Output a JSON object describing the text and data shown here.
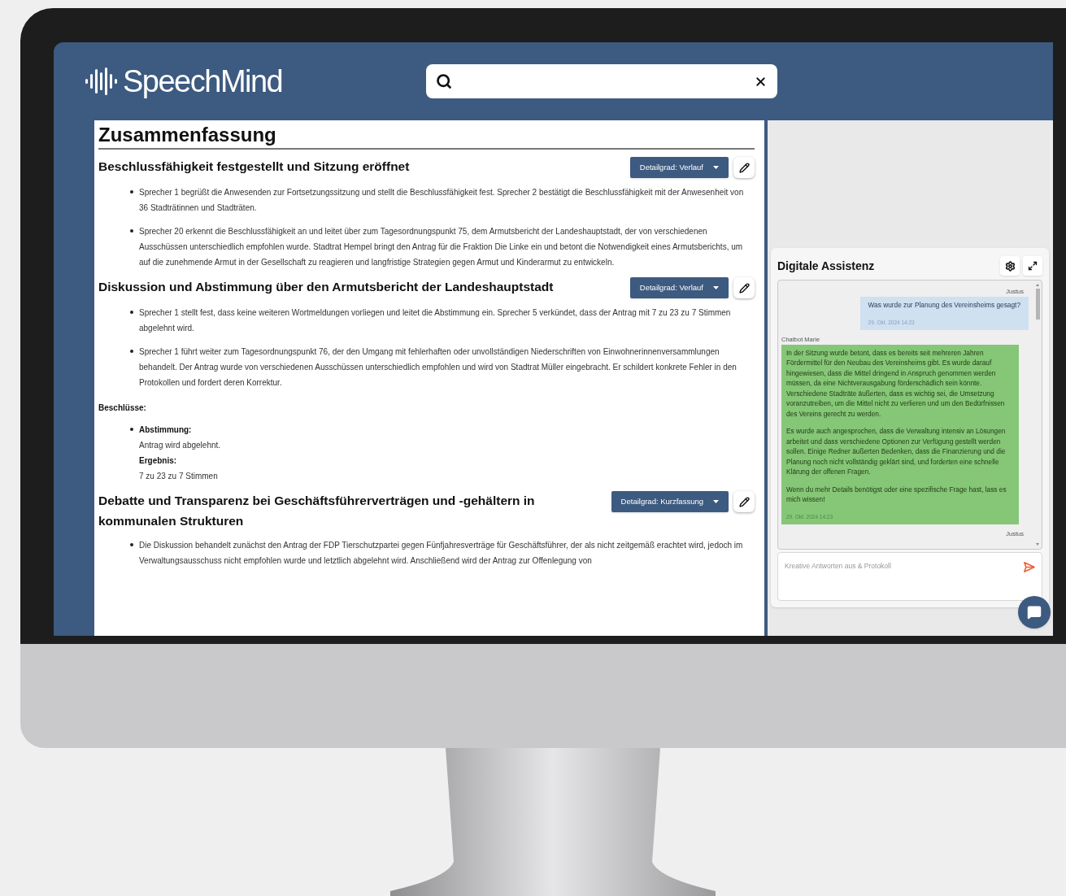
{
  "header": {
    "logo": "SpeechMind"
  },
  "summary": {
    "title": "Zusammenfassung",
    "sections": [
      {
        "title": "Beschlussfähigkeit festgestellt und Sitzung eröffnet",
        "detail_button": "Detailgrad: Verlauf",
        "items": [
          "Sprecher 1 begrüßt die Anwesenden zur Fortsetzungssitzung und stellt die Beschlussfähigkeit fest. Sprecher 2 bestätigt die Beschlussfähigkeit mit der Anwesenheit von 36 Stadträtinnen und Stadträten.",
          "Sprecher 20 erkennt die Beschlussfähigkeit an und leitet über zum Tagesordnungspunkt 75, dem Armutsbericht der Landeshauptstadt, der von verschiedenen Ausschüssen unterschiedlich empfohlen wurde. Stadtrat Hempel bringt den Antrag für die Fraktion Die Linke ein und betont die Notwendigkeit eines Armutsberichts, um auf die zunehmende Armut in der Gesellschaft zu reagieren und langfristige Strategien gegen Armut und Kinderarmut zu entwickeln."
        ]
      },
      {
        "title": "Diskussion und Abstimmung über den Armutsbericht der Landeshauptstadt",
        "detail_button": "Detailgrad: Verlauf",
        "items": [
          "Sprecher 1 stellt fest, dass keine weiteren Wortmeldungen vorliegen und leitet die Abstimmung ein. Sprecher 5 verkündet, dass der Antrag mit 7 zu 23 zu 7 Stimmen abgelehnt wird.",
          "Sprecher 1 führt weiter zum Tagesordnungspunkt 76, der den Umgang mit fehlerhaften oder unvollständigen Niederschriften von Einwohnerinnenversammlungen behandelt. Der Antrag wurde von verschiedenen Ausschüssen unterschiedlich empfohlen und wird von Stadtrat Müller eingebracht. Er schildert konkrete Fehler in den Protokollen und fordert deren Korrektur."
        ],
        "decisions": {
          "title": "Beschlüsse:",
          "entries": [
            {
              "label": "Abstimmung:",
              "value": "Antrag wird abgelehnt."
            },
            {
              "label": "Ergebnis:",
              "value": "7 zu 23 zu 7 Stimmen"
            }
          ]
        }
      },
      {
        "title": "Debatte und Transparenz bei Geschäftsführerverträgen und -gehältern in kommunalen Strukturen",
        "detail_button": "Detailgrad: Kurzfassung",
        "items": [
          "Die Diskussion behandelt zunächst den Antrag der FDP Tierschutzpartei gegen Fünfjahresverträge für Geschäftsführer, der als nicht zeitgemäß erachtet wird, jedoch im Verwaltungsausschuss nicht empfohlen wurde und letztlich abgelehnt wird. Anschließend wird der Antrag zur Offenlegung von"
        ]
      }
    ]
  },
  "chat": {
    "title": "Digitale Assistenz",
    "messages": [
      {
        "kind": "user",
        "sender": "Justus",
        "paragraphs": [
          "Was wurde zur Planung des Vereinsheims gesagt?"
        ],
        "time": "29. Okt. 2024 14:23"
      },
      {
        "kind": "bot",
        "sender": "Chatbot Marie",
        "paragraphs": [
          "In der Sitzung wurde betont, dass es bereits seit mehreren Jahren Fördermittel für den Neubau des Vereinsheims gibt. Es wurde darauf hingewiesen, dass die Mittel dringend in Anspruch genommen werden müssen, da eine Nichtverausgabung förderschädlich sein könnte. Verschiedene Stadträte äußerten, dass es wichtig sei, die Umsetzung voranzutreiben, um die Mittel nicht zu verlieren und um den Bedürfnissen des Vereins gerecht zu werden.",
          "Es wurde auch angesprochen, dass die Verwaltung intensiv an Lösungen arbeitet und dass verschiedene Optionen zur Verfügung gestellt werden sollen. Einige Redner äußerten Bedenken, dass die Finanzierung und die Planung noch nicht vollständig geklärt sind, und forderten eine schnelle Klärung der offenen Fragen.",
          "Wenn du mehr Details benötigst oder eine spezifische Frage hast, lass es mich wissen!"
        ],
        "time": "29. Okt. 2024 14:23"
      },
      {
        "kind": "user",
        "sender": "Justus"
      }
    ],
    "input": {
      "placeholder": "Kreative Antworten aus & Protokoll"
    }
  }
}
